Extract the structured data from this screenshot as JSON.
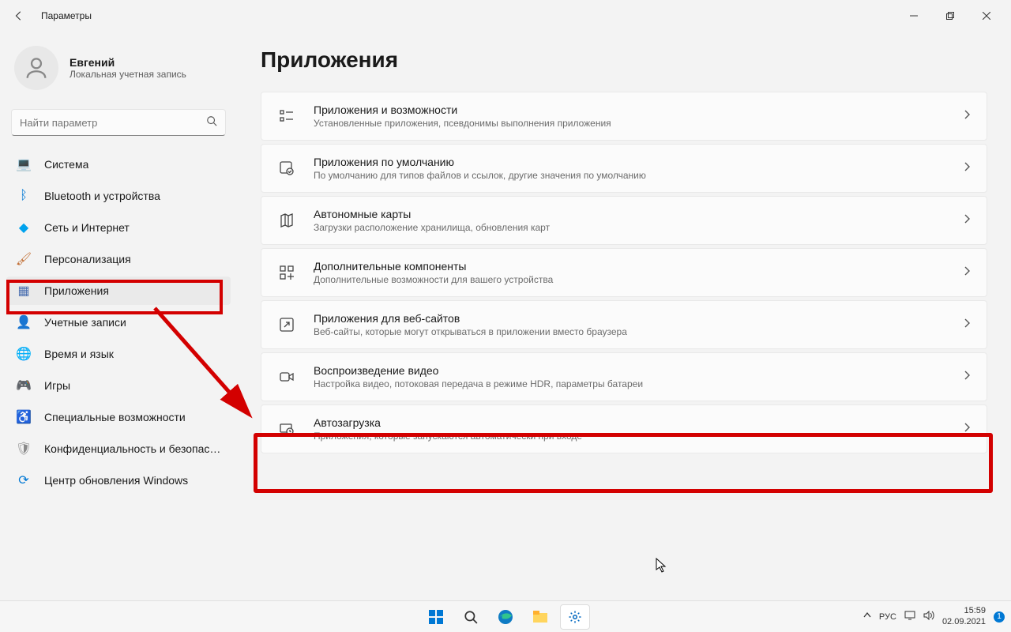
{
  "window": {
    "title": "Параметры"
  },
  "user": {
    "name": "Евгений",
    "account_type": "Локальная учетная запись"
  },
  "search": {
    "placeholder": "Найти параметр"
  },
  "sidebar": {
    "items": [
      {
        "label": "Система",
        "icon": "system-icon",
        "color": "#0078d4"
      },
      {
        "label": "Bluetooth и устройства",
        "icon": "bluetooth-icon",
        "color": "#0078d4"
      },
      {
        "label": "Сеть и Интернет",
        "icon": "network-icon",
        "color": "#00a2ed"
      },
      {
        "label": "Персонализация",
        "icon": "personalization-icon",
        "color": "#c06b2f"
      },
      {
        "label": "Приложения",
        "icon": "apps-icon",
        "color": "#4a6fb0",
        "selected": true
      },
      {
        "label": "Учетные записи",
        "icon": "accounts-icon",
        "color": "#2e9b55"
      },
      {
        "label": "Время и язык",
        "icon": "time-language-icon",
        "color": "#4a6fb0"
      },
      {
        "label": "Игры",
        "icon": "gaming-icon",
        "color": "#888"
      },
      {
        "label": "Специальные возможности",
        "icon": "accessibility-icon",
        "color": "#5aa0d8"
      },
      {
        "label": "Конфиденциальность и безопасность",
        "icon": "privacy-icon",
        "color": "#888"
      },
      {
        "label": "Центр обновления Windows",
        "icon": "update-icon",
        "color": "#0078d4"
      }
    ]
  },
  "page": {
    "title": "Приложения",
    "cards": [
      {
        "title": "Приложения и возможности",
        "sub": "Установленные приложения, псевдонимы выполнения приложения",
        "icon": "apps-features-icon"
      },
      {
        "title": "Приложения по умолчанию",
        "sub": "По умолчанию для типов файлов и ссылок, другие значения по умолчанию",
        "icon": "default-apps-icon"
      },
      {
        "title": "Автономные карты",
        "sub": "Загрузки расположение хранилища, обновления карт",
        "icon": "maps-icon"
      },
      {
        "title": "Дополнительные компоненты",
        "sub": "Дополнительные возможности для вашего устройства",
        "icon": "optional-features-icon"
      },
      {
        "title": "Приложения для веб-сайтов",
        "sub": "Веб-сайты, которые могут открываться в приложении вместо браузера",
        "icon": "web-apps-icon"
      },
      {
        "title": "Воспроизведение видео",
        "sub": "Настройка видео, потоковая передача в режиме HDR, параметры батареи",
        "icon": "video-icon"
      },
      {
        "title": "Автозагрузка",
        "sub": "Приложения, которые запускаются автоматически при входе",
        "icon": "startup-icon"
      }
    ]
  },
  "taskbar": {
    "lang": "РУС",
    "time": "15:59",
    "date": "02.09.2021",
    "notifications": "1"
  },
  "annotations": {
    "highlight_color": "#d30000"
  }
}
